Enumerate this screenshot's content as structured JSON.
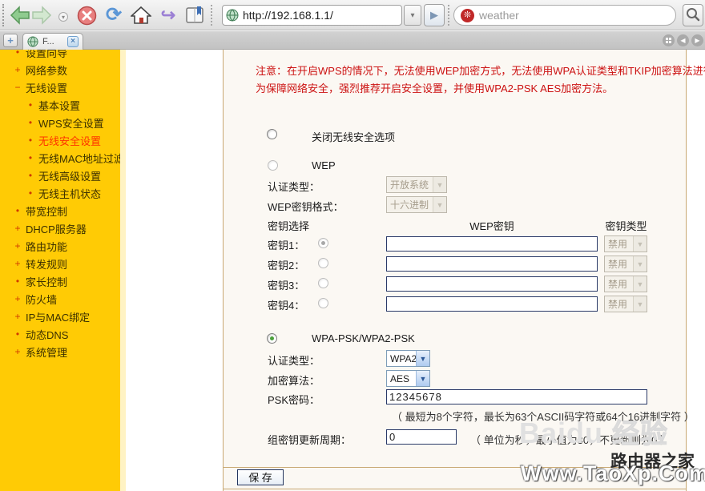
{
  "browser": {
    "url_value": "http://192.168.1.1/",
    "search_placeholder": "weather",
    "tab_title": "F...",
    "icons": {
      "refresh": "⟳",
      "send": "↪",
      "go": "▶",
      "new_tab": "+",
      "tab_close": "×",
      "url_dropdown": "▾",
      "nav_dropdown": "▾",
      "tab_prev": "◀",
      "tab_next": "▶",
      "search_engine_glyph": "❊"
    }
  },
  "sidebar": {
    "items": [
      {
        "bullet": "•",
        "label": "设置向导"
      },
      {
        "bullet": "+",
        "label": "网络参数"
      },
      {
        "bullet": "−",
        "label": "无线设置"
      },
      {
        "bullet": "•",
        "label": "基本设置"
      },
      {
        "bullet": "•",
        "label": "WPS安全设置"
      },
      {
        "bullet": "•",
        "label": "无线安全设置"
      },
      {
        "bullet": "•",
        "label": "无线MAC地址过滤"
      },
      {
        "bullet": "•",
        "label": "无线高级设置"
      },
      {
        "bullet": "•",
        "label": "无线主机状态"
      },
      {
        "bullet": "•",
        "label": "带宽控制"
      },
      {
        "bullet": "+",
        "label": "DHCP服务器"
      },
      {
        "bullet": "+",
        "label": "路由功能"
      },
      {
        "bullet": "+",
        "label": "转发规则"
      },
      {
        "bullet": "•",
        "label": "家长控制"
      },
      {
        "bullet": "+",
        "label": "防火墙"
      },
      {
        "bullet": "+",
        "label": "IP与MAC绑定"
      },
      {
        "bullet": "•",
        "label": "动态DNS"
      },
      {
        "bullet": "+",
        "label": "系统管理"
      }
    ]
  },
  "content": {
    "notice_line1": "注意：在开启WPS的情况下，无法使用WEP加密方式，无法使用WPA认证类型和TKIP加密算法进行加密",
    "notice_line2": "为保障网络安全，强烈推荐开启安全设置，并使用WPA2-PSK AES加密方法。",
    "option_disable_label": "关闭无线安全选项",
    "wep": {
      "title": "WEP",
      "auth_label": "认证类型：",
      "auth_value": "开放系统",
      "format_label": "WEP密钥格式：",
      "format_value": "十六进制",
      "key_select_header": "密钥选择",
      "wep_key_header": "WEP密钥",
      "key_type_header": "密钥类型",
      "keys": [
        {
          "label": "密钥1：",
          "value": "",
          "type": "禁用"
        },
        {
          "label": "密钥2：",
          "value": "",
          "type": "禁用"
        },
        {
          "label": "密钥3：",
          "value": "",
          "type": "禁用"
        },
        {
          "label": "密钥4：",
          "value": "",
          "type": "禁用"
        }
      ]
    },
    "wpa": {
      "title": "WPA-PSK/WPA2-PSK",
      "auth_label": "认证类型：",
      "auth_value": "WPA2",
      "alg_label": "加密算法：",
      "alg_value": "AES",
      "psk_label": "PSK密码：",
      "psk_value": "12345678",
      "psk_note": "（ 最短为8个字符，最长为63个ASCII码字符或64个16进制字符 ）",
      "gtk_label": "组密钥更新周期：",
      "gtk_value": "0",
      "gtk_note": "（ 单位为秒，最小值为30，不更新则为0 ）"
    },
    "save_label": "保 存"
  },
  "watermarks": {
    "baidu_en": "Baidu",
    "baidu_cn": "经验",
    "router_home": "路由器之家",
    "site": "Www.TaoXp.Com"
  },
  "colors": {
    "sidebar_bg": "#ffcb05",
    "sidebar_active_text": "#ff3300",
    "notice_red": "#cc1111",
    "panel_border": "#c8a872"
  }
}
